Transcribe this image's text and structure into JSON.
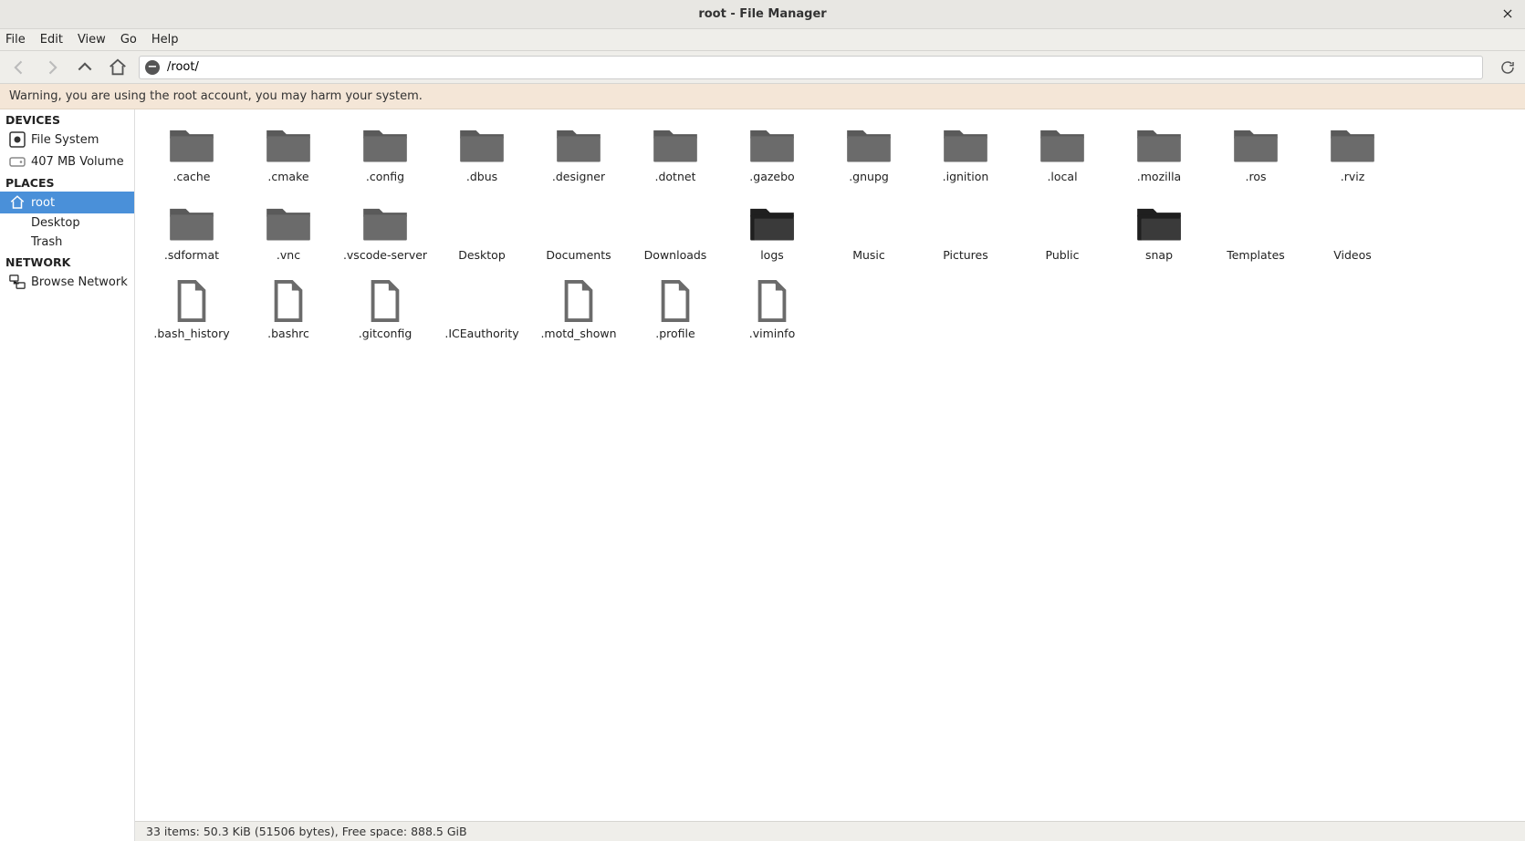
{
  "window": {
    "title": "root - File Manager"
  },
  "menu": {
    "file": "File",
    "edit": "Edit",
    "view": "View",
    "go": "Go",
    "help": "Help"
  },
  "path": "/root/",
  "warning": "Warning, you are using the root account, you may harm your system.",
  "sidebar": {
    "devices_hdr": "DEVICES",
    "places_hdr": "PLACES",
    "network_hdr": "NETWORK",
    "devices": [
      {
        "label": "File System"
      },
      {
        "label": "407 MB Volume"
      }
    ],
    "places": [
      {
        "label": "root"
      },
      {
        "label": "Desktop"
      },
      {
        "label": "Trash"
      }
    ],
    "network": [
      {
        "label": "Browse Network"
      }
    ]
  },
  "items": [
    {
      "name": ".cache",
      "type": "folder"
    },
    {
      "name": ".cmake",
      "type": "folder"
    },
    {
      "name": ".config",
      "type": "folder"
    },
    {
      "name": ".dbus",
      "type": "folder"
    },
    {
      "name": ".designer",
      "type": "folder"
    },
    {
      "name": ".dotnet",
      "type": "folder"
    },
    {
      "name": ".gazebo",
      "type": "folder"
    },
    {
      "name": ".gnupg",
      "type": "folder"
    },
    {
      "name": ".ignition",
      "type": "folder"
    },
    {
      "name": ".local",
      "type": "folder"
    },
    {
      "name": ".mozilla",
      "type": "folder"
    },
    {
      "name": ".ros",
      "type": "folder"
    },
    {
      "name": ".rviz",
      "type": "folder"
    },
    {
      "name": ".sdformat",
      "type": "folder"
    },
    {
      "name": ".vnc",
      "type": "folder"
    },
    {
      "name": ".vscode-server",
      "type": "folder"
    },
    {
      "name": "Desktop",
      "type": "folder-nobody"
    },
    {
      "name": "Documents",
      "type": "folder-nobody"
    },
    {
      "name": "Downloads",
      "type": "folder-nobody"
    },
    {
      "name": "logs",
      "type": "folder-open"
    },
    {
      "name": "Music",
      "type": "folder-nobody"
    },
    {
      "name": "Pictures",
      "type": "folder-nobody"
    },
    {
      "name": "Public",
      "type": "folder-nobody"
    },
    {
      "name": "snap",
      "type": "folder-open"
    },
    {
      "name": "Templates",
      "type": "folder-nobody"
    },
    {
      "name": "Videos",
      "type": "folder-nobody"
    },
    {
      "name": ".bash_history",
      "type": "file"
    },
    {
      "name": ".bashrc",
      "type": "file"
    },
    {
      "name": ".gitconfig",
      "type": "file"
    },
    {
      "name": ".ICEauthority",
      "type": "file-nobody"
    },
    {
      "name": ".motd_shown",
      "type": "file"
    },
    {
      "name": ".profile",
      "type": "file"
    },
    {
      "name": ".viminfo",
      "type": "file"
    }
  ],
  "status": "33 items: 50.3 KiB (51506 bytes), Free space: 888.5 GiB"
}
